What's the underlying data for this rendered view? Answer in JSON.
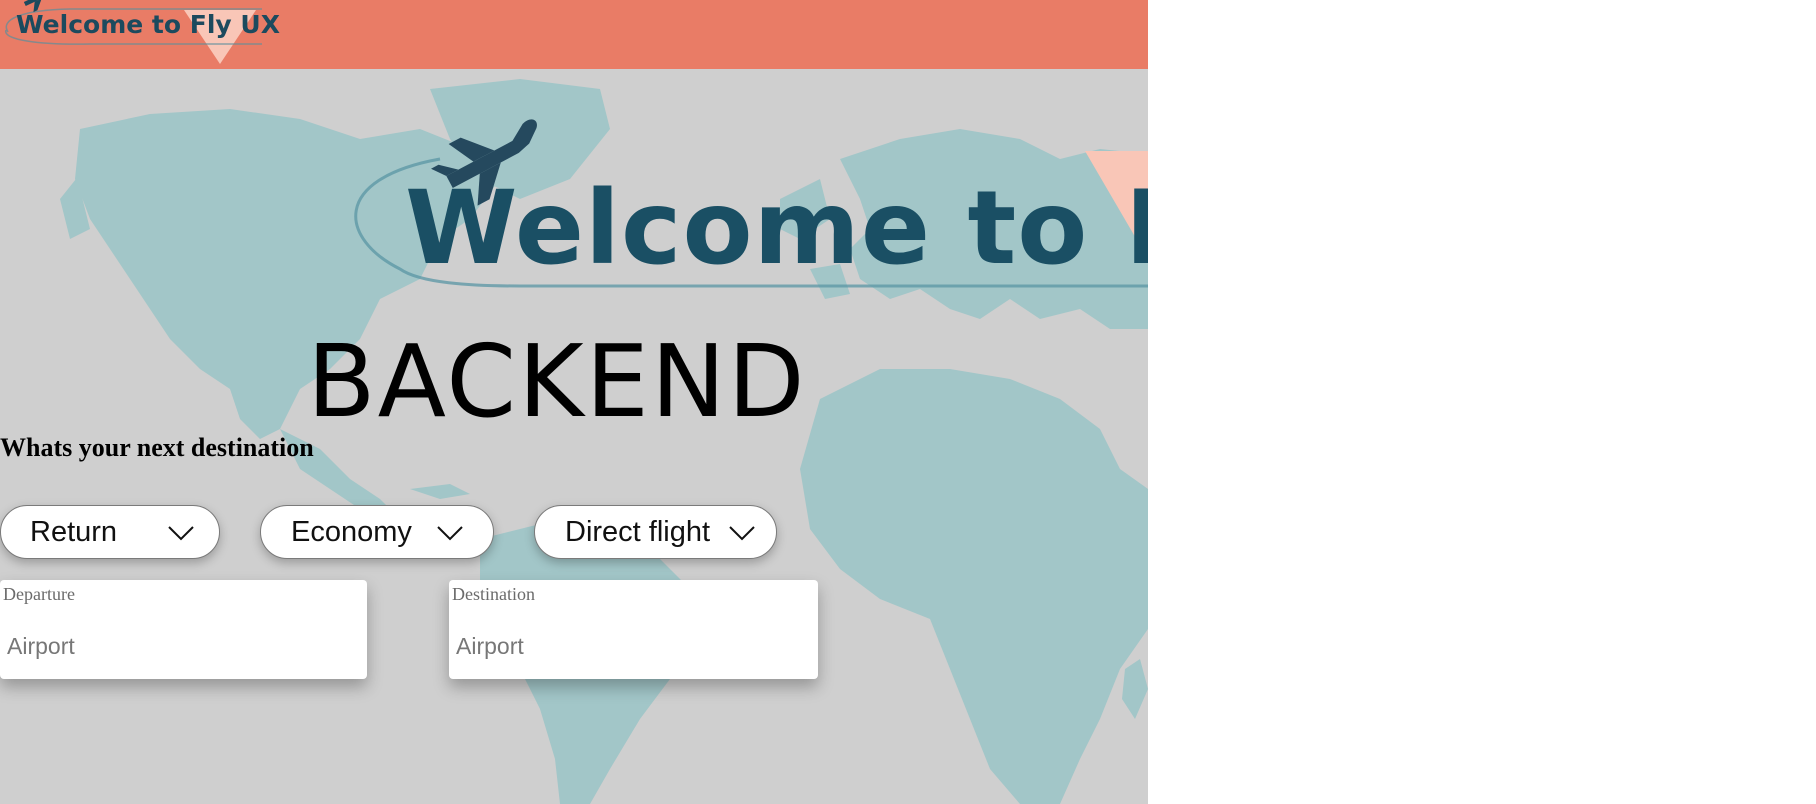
{
  "header": {
    "logo_text": "Welcome to Fly UX"
  },
  "hero": {
    "title": "Welcome to Fly UX",
    "subtitle": "BACKEND",
    "tagline": "Whats your next destination"
  },
  "filters": {
    "trip_type": {
      "value": "Return"
    },
    "cabin_class": {
      "value": "Economy"
    },
    "stops": {
      "value": "Direct flight"
    }
  },
  "departure": {
    "label": "Departure",
    "placeholder": "Airport"
  },
  "destination": {
    "label": "Destination",
    "placeholder": "Airport"
  },
  "icons": {
    "logo_plane": "airplane-icon",
    "hero_plane": "airplane-icon",
    "chevron": "chevron-down-icon"
  },
  "colors": {
    "header_bg": "#e97c66",
    "brand_dark": "#1c4a5e",
    "accent_triangle": "#f9c6b7",
    "hero_bg": "#cfcfcf",
    "map_land": "#a2c6c8"
  }
}
